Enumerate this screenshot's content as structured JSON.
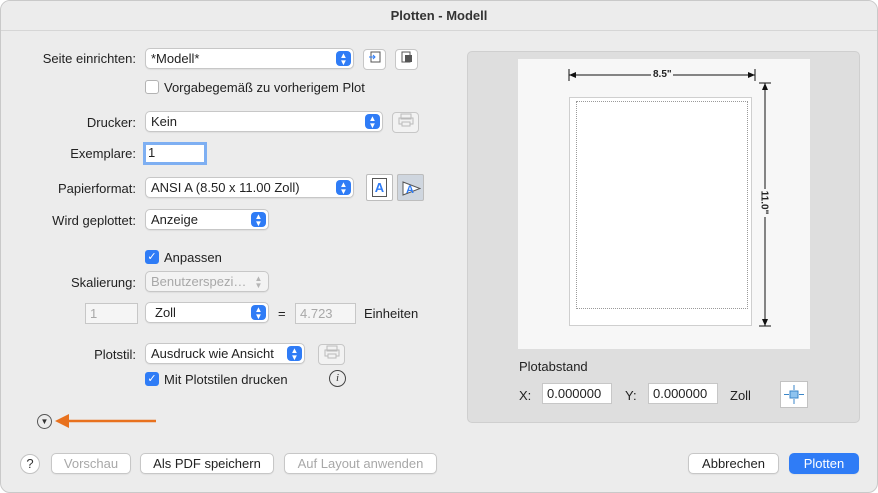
{
  "window": {
    "title": "Plotten - Modell"
  },
  "page_setup": {
    "label": "Seite einrichten:",
    "value": "*Modell*",
    "default_checkbox_label": "Vorgabegemäß zu vorherigem Plot",
    "default_checked": false
  },
  "printer": {
    "label": "Drucker:",
    "value": "Kein"
  },
  "copies": {
    "label": "Exemplare:",
    "value": "1"
  },
  "paper": {
    "label": "Papierformat:",
    "value": "ANSI A (8.50 x 11.00 Zoll)"
  },
  "plot_area": {
    "label": "Wird geplottet:",
    "value": "Anzeige"
  },
  "scale": {
    "fit_label": "Anpassen",
    "fit_checked": true,
    "label": "Skalierung:",
    "preset": "Benutzerspezi…",
    "left_value": "1",
    "unit": "Zoll",
    "equals": "=",
    "right_value": "4.723",
    "units_label": "Einheiten"
  },
  "plot_style": {
    "label": "Plotstil:",
    "value": "Ausdruck wie Ansicht",
    "with_styles_label": "Mit Plotstilen drucken",
    "with_styles_checked": true
  },
  "preview": {
    "width_label": "8.5\"",
    "height_label": "11.0\""
  },
  "offset": {
    "title": "Plotabstand",
    "x_label": "X:",
    "x_value": "0.000000",
    "y_label": "Y:",
    "y_value": "0.000000",
    "unit": "Zoll"
  },
  "buttons": {
    "help": "?",
    "preview": "Vorschau",
    "save_pdf": "Als PDF speichern",
    "apply_layout": "Auf Layout anwenden",
    "cancel": "Abbrechen",
    "plot": "Plotten"
  },
  "colors": {
    "accent": "#2f7cf6",
    "annotation_arrow": "#e8711e"
  }
}
